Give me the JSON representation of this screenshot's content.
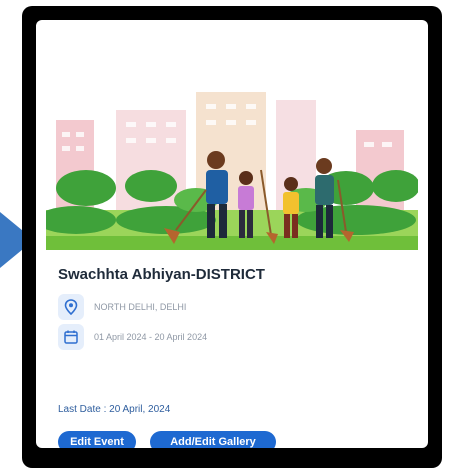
{
  "event": {
    "title": "Swachhta Abhiyan-DISTRICT",
    "location": "NORTH DELHI, DELHI",
    "date_range": "01 April 2024 - 20 April 2024",
    "last_date": "Last Date : 20 April, 2024"
  },
  "actions": {
    "edit_label": "Edit Event",
    "gallery_label": "Add/Edit Gallery"
  },
  "colors": {
    "accent": "#1e69d1",
    "pointer": "#3a78c2",
    "icon_bg": "#e5eefb"
  },
  "icons": {
    "location": "location-pin-icon",
    "date": "calendar-icon"
  }
}
